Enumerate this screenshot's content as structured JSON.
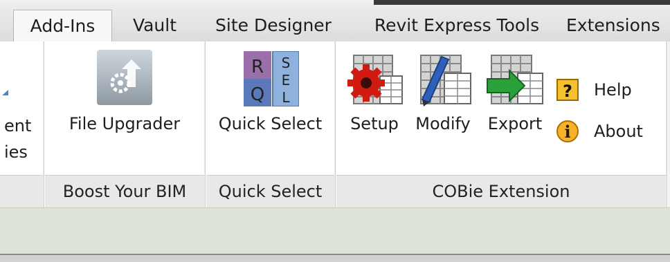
{
  "tabs": [
    {
      "label": "Add-Ins",
      "active": true
    },
    {
      "label": "Vault",
      "active": false
    },
    {
      "label": "Site Designer",
      "active": false
    },
    {
      "label": "Revit Express Tools",
      "active": false
    },
    {
      "label": "Extensions",
      "active": false
    }
  ],
  "partial_panel": {
    "line1": "ent",
    "line2": "ies"
  },
  "panels": {
    "boost": {
      "label": "Boost Your BIM",
      "button": "File Upgrader"
    },
    "quick": {
      "label": "Quick Select",
      "button": "Quick Select",
      "icon_letters": [
        "R",
        "S",
        "E",
        "L",
        "Q"
      ]
    },
    "cobie": {
      "label": "COBie Extension",
      "buttons": {
        "setup": "Setup",
        "modify": "Modify",
        "export": "Export"
      },
      "small": {
        "help": "Help",
        "about": "About"
      },
      "help_glyph": "?",
      "about_glyph": "i"
    }
  },
  "icons": [
    "file-upgrader-icon",
    "quick-select-icon",
    "cobie-setup-icon",
    "cobie-modify-icon",
    "cobie-export-icon",
    "help-icon",
    "about-icon"
  ]
}
